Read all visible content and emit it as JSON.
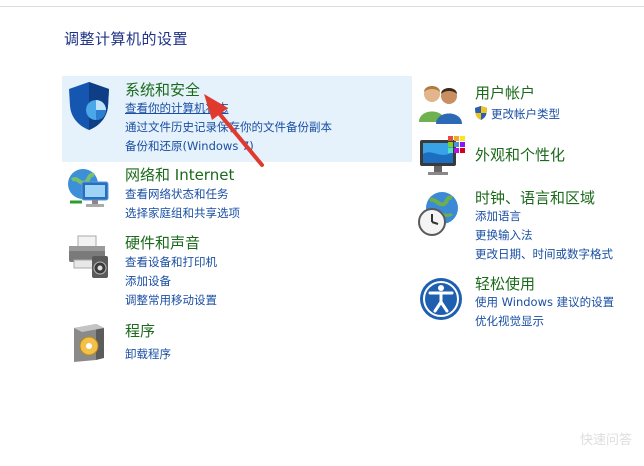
{
  "page_title": "调整计算机的设置",
  "left_column": {
    "system_security": {
      "title": "系统和安全",
      "links": [
        "查看你的计算机状态",
        "通过文件历史记录保存你的文件备份副本",
        "备份和还原(Windows 7)"
      ]
    },
    "network": {
      "title": "网络和 Internet",
      "links": [
        "查看网络状态和任务",
        "选择家庭组和共享选项"
      ]
    },
    "hardware": {
      "title": "硬件和声音",
      "links": [
        "查看设备和打印机",
        "添加设备",
        "调整常用移动设置"
      ]
    },
    "programs": {
      "title": "程序",
      "links": [
        "卸载程序"
      ]
    }
  },
  "right_column": {
    "user_accounts": {
      "title": "用户帐户",
      "links": [
        "更改帐户类型"
      ]
    },
    "appearance": {
      "title": "外观和个性化"
    },
    "clock_region": {
      "title": "时钟、语言和区域",
      "links": [
        "添加语言",
        "更换输入法",
        "更改日期、时间或数字格式"
      ]
    },
    "ease_of_access": {
      "title": "轻松使用",
      "links": [
        "使用 Windows 建议的设置",
        "优化视觉显示"
      ]
    }
  },
  "watermark": "快速问答",
  "colors": {
    "title_green": "#1b6a1b",
    "link_blue": "#1a4fa3",
    "highlight": "#e5f1fb",
    "arrow_red": "#e03a2f"
  },
  "icons": [
    "shield-icon",
    "network-icon",
    "printer-icon",
    "programs-icon",
    "users-icon",
    "uac-shield-icon",
    "monitor-icon",
    "clock-globe-icon",
    "ease-of-access-icon"
  ]
}
